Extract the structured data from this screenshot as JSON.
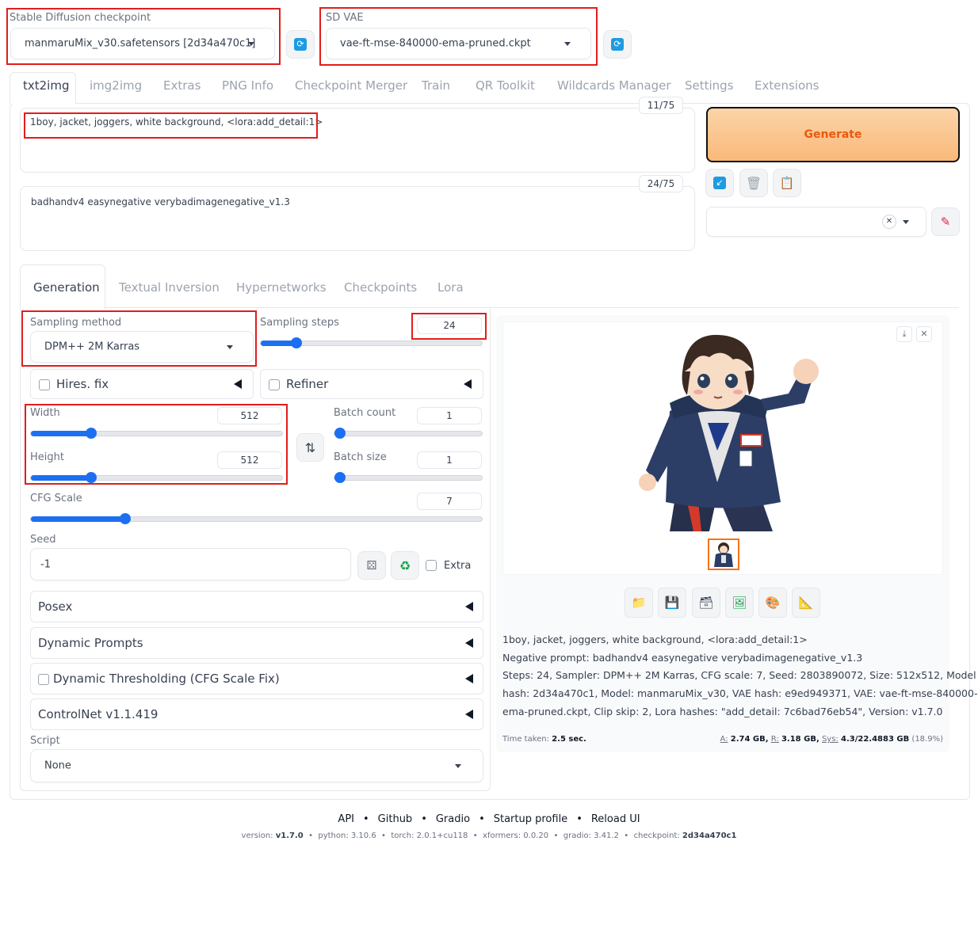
{
  "top": {
    "checkpoint_label": "Stable Diffusion checkpoint",
    "checkpoint_value": "manmaruMix_v30.safetensors [2d34a470c1]",
    "vae_label": "SD VAE",
    "vae_value": "vae-ft-mse-840000-ema-pruned.ckpt"
  },
  "tabs": [
    "txt2img",
    "img2img",
    "Extras",
    "PNG Info",
    "Checkpoint Merger",
    "Train",
    "QR Toolkit",
    "Wildcards Manager",
    "Settings",
    "Extensions"
  ],
  "prompt": {
    "positive": "1boy, jacket, joggers, white background,  <lora:add_detail:1>",
    "positive_count": "11/75",
    "negative": "badhandv4 easynegative verybadimagenegative_v1.3",
    "negative_count": "24/75"
  },
  "generate_label": "Generate",
  "style_close": "✕",
  "subtabs": [
    "Generation",
    "Textual Inversion",
    "Hypernetworks",
    "Checkpoints",
    "Lora"
  ],
  "generation": {
    "sampling_method_label": "Sampling method",
    "sampling_method_value": "DPM++ 2M Karras",
    "sampling_steps_label": "Sampling steps",
    "sampling_steps_value": "24",
    "hires_label": "Hires. fix",
    "refiner_label": "Refiner",
    "width_label": "Width",
    "width_value": "512",
    "height_label": "Height",
    "height_value": "512",
    "batch_count_label": "Batch count",
    "batch_count_value": "1",
    "batch_size_label": "Batch size",
    "batch_size_value": "1",
    "cfg_label": "CFG Scale",
    "cfg_value": "7",
    "seed_label": "Seed",
    "seed_value": "-1",
    "extra_label": "Extra",
    "accordions": [
      "Posex",
      "Dynamic Prompts",
      "Dynamic Thresholding (CFG Scale Fix)",
      "ControlNet v1.1.419"
    ],
    "script_label": "Script",
    "script_value": "None"
  },
  "sliders": {
    "steps_fraction": 0.16,
    "width_fraction": 0.24,
    "height_fraction": 0.24,
    "batch_count_fraction": 0.0,
    "batch_size_fraction": 0.0,
    "cfg_fraction": 0.21
  },
  "output": {
    "line1": "1boy, jacket, joggers, white background, <lora:add_detail:1>",
    "line2": "Negative prompt: badhandv4 easynegative verybadimagenegative_v1.3",
    "line3": "Steps: 24, Sampler: DPM++ 2M Karras, CFG scale: 7, Seed: 2803890072, Size: 512x512, Model",
    "line4": "hash: 2d34a470c1, Model: manmaruMix_v30, VAE hash: e9ed949371, VAE: vae-ft-mse-840000-",
    "line5": "ema-pruned.ckpt, Clip skip: 2, Lora hashes: \"add_detail: 7c6bad76eb54\", Version: v1.7.0",
    "time_label": "Time taken:",
    "time_value": "2.5 sec.",
    "mem_a_label": "A:",
    "mem_a": "2.74 GB,",
    "mem_r_label": "R:",
    "mem_r": "3.18 GB,",
    "mem_sys_label": "Sys:",
    "mem_sys": "4.3/22.4883 GB",
    "mem_pct": "(18.9%)"
  },
  "footer": {
    "links": [
      "API",
      "Github",
      "Gradio",
      "Startup profile",
      "Reload UI"
    ],
    "ver_label": "version:",
    "ver": "v1.7.0",
    "python_label": "python:",
    "python": "3.10.6",
    "torch_label": "torch:",
    "torch": "2.0.1+cu118",
    "xformers_label": "xformers:",
    "xformers": "0.0.20",
    "gradio_label": "gradio:",
    "gradio": "3.41.2",
    "ckpt_label": "checkpoint:",
    "ckpt": "2d34a470c1"
  },
  "colors": {
    "accent": "#1d6ff2",
    "generate_bg": "#fbc58f",
    "generate_text": "#ea580c",
    "highlight": "#e11d1d"
  }
}
